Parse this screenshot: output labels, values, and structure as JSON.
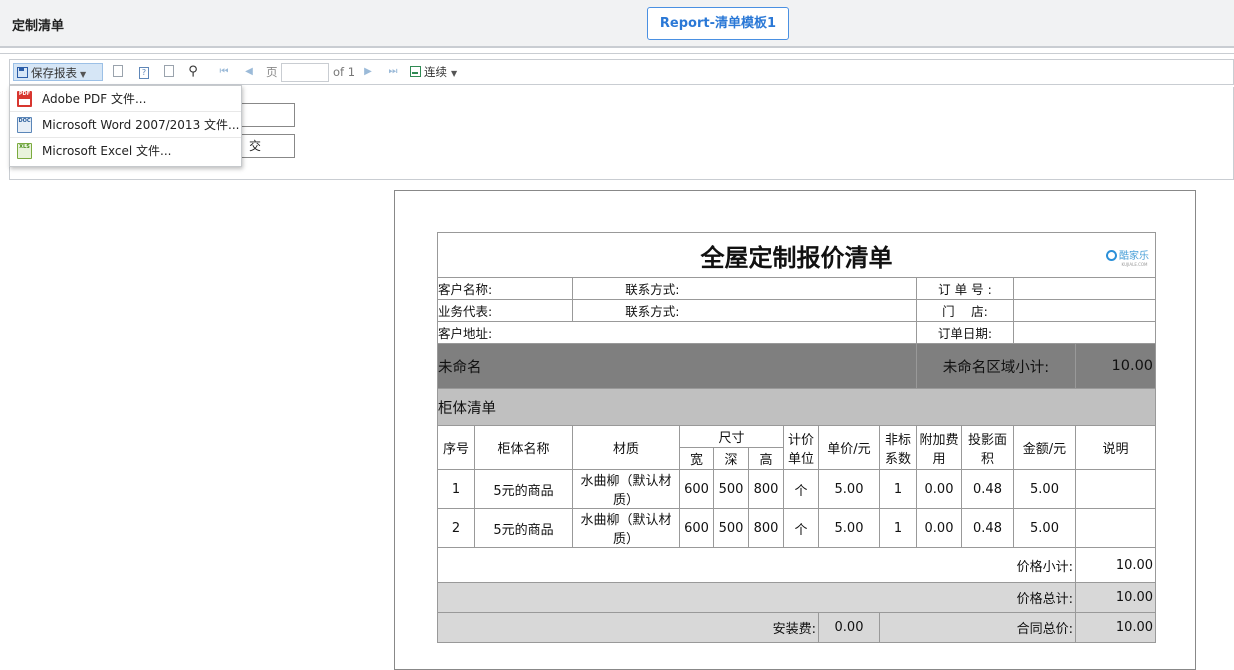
{
  "app": {
    "title": "定制清单",
    "template_button": "Report-清单模板1"
  },
  "toolbar": {
    "save_label": "保存报表",
    "page_label": "页",
    "page_value": "",
    "of_label": "of 1",
    "continuous_label": "连续"
  },
  "save_menu": [
    {
      "icon": "pdf-file-icon",
      "badge": "PDF",
      "label": "Adobe PDF 文件..."
    },
    {
      "icon": "word-file-icon",
      "badge": "DOC",
      "label": "Microsoft Word 2007/2013 文件..."
    },
    {
      "icon": "excel-file-icon",
      "badge": "XLS",
      "label": "Microsoft Excel 文件..."
    }
  ],
  "params": {
    "submit_label": "交"
  },
  "report": {
    "title": "全屋定制报价清单",
    "logo_text": "酷家乐",
    "logo_sub": "KUJIALE.COM",
    "customer_name_label": "客户名称:",
    "contact_label_1": "联系方式:",
    "order_no_label": "订 单 号 :",
    "sales_rep_label": "业务代表:",
    "contact_label_2": "联系方式:",
    "store_label": "门　 店:",
    "address_label": "客户地址:",
    "order_date_label": "订单日期:",
    "area_name": "未命名",
    "area_subtotal_label": "未命名区域小计:",
    "area_subtotal_value": "10.00",
    "section_title": "柜体清单",
    "headers": {
      "no": "序号",
      "name": "柜体名称",
      "material": "材质",
      "size": "尺寸",
      "width": "宽",
      "depth": "深",
      "height": "高",
      "unit": "计价单位",
      "unit_price": "单价/元",
      "nonstd": "非标系数",
      "extra": "附加费用",
      "proj_area": "投影面积",
      "amount": "金额/元",
      "note": "说明"
    },
    "rows": [
      {
        "no": "1",
        "name": "5元的商品",
        "material": "水曲柳（默认材质）",
        "w": "600",
        "d": "500",
        "h": "800",
        "unit": "个",
        "price": "5.00",
        "coef": "1",
        "extra": "0.00",
        "area": "0.48",
        "amount": "5.00",
        "note": ""
      },
      {
        "no": "2",
        "name": "5元的商品",
        "material": "水曲柳（默认材质）",
        "w": "600",
        "d": "500",
        "h": "800",
        "unit": "个",
        "price": "5.00",
        "coef": "1",
        "extra": "0.00",
        "area": "0.48",
        "amount": "5.00",
        "note": ""
      }
    ],
    "price_subtotal_label": "价格小计:",
    "price_subtotal_value": "10.00",
    "price_total_label": "价格总计:",
    "price_total_value": "10.00",
    "install_fee_label": "安装费:",
    "install_fee_value": "0.00",
    "contract_total_label": "合同总价:",
    "contract_total_value": "10.00"
  }
}
